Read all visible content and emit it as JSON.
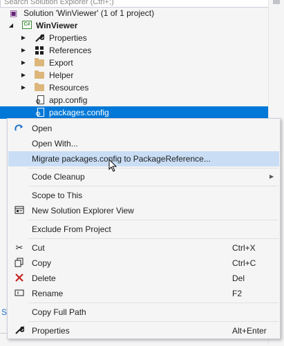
{
  "search": {
    "placeholder": "Search Solution Explorer (Ctrl+;)"
  },
  "tree": {
    "solution": "Solution 'WinViewer' (1 of 1 project)",
    "project": "WinViewer",
    "project_badge": "C#",
    "items": [
      {
        "label": "Properties",
        "icon": "wrench-icon"
      },
      {
        "label": "References",
        "icon": "references-icon"
      },
      {
        "label": "Export",
        "icon": "folder-icon"
      },
      {
        "label": "Helper",
        "icon": "folder-icon"
      },
      {
        "label": "Resources",
        "icon": "folder-icon"
      },
      {
        "label": "app.config",
        "icon": "config-file-icon"
      },
      {
        "label": "packages.config",
        "icon": "config-file-icon"
      }
    ]
  },
  "menu": {
    "open": "Open",
    "open_with": "Open With...",
    "migrate": "Migrate packages.config to PackageReference...",
    "code_cleanup": "Code Cleanup",
    "scope_to_this": "Scope to This",
    "new_view": "New Solution Explorer View",
    "exclude": "Exclude From Project",
    "cut": "Cut",
    "cut_shortcut": "Ctrl+X",
    "copy": "Copy",
    "copy_shortcut": "Ctrl+C",
    "delete": "Delete",
    "delete_shortcut": "Del",
    "rename": "Rename",
    "rename_shortcut": "F2",
    "copy_full_path": "Copy Full Path",
    "properties": "Properties",
    "properties_shortcut": "Alt+Enter"
  },
  "colors": {
    "selection": "#0078d7",
    "menu_hover": "#c9def5",
    "folder": "#dcb67a",
    "delete_red": "#c5221f"
  }
}
